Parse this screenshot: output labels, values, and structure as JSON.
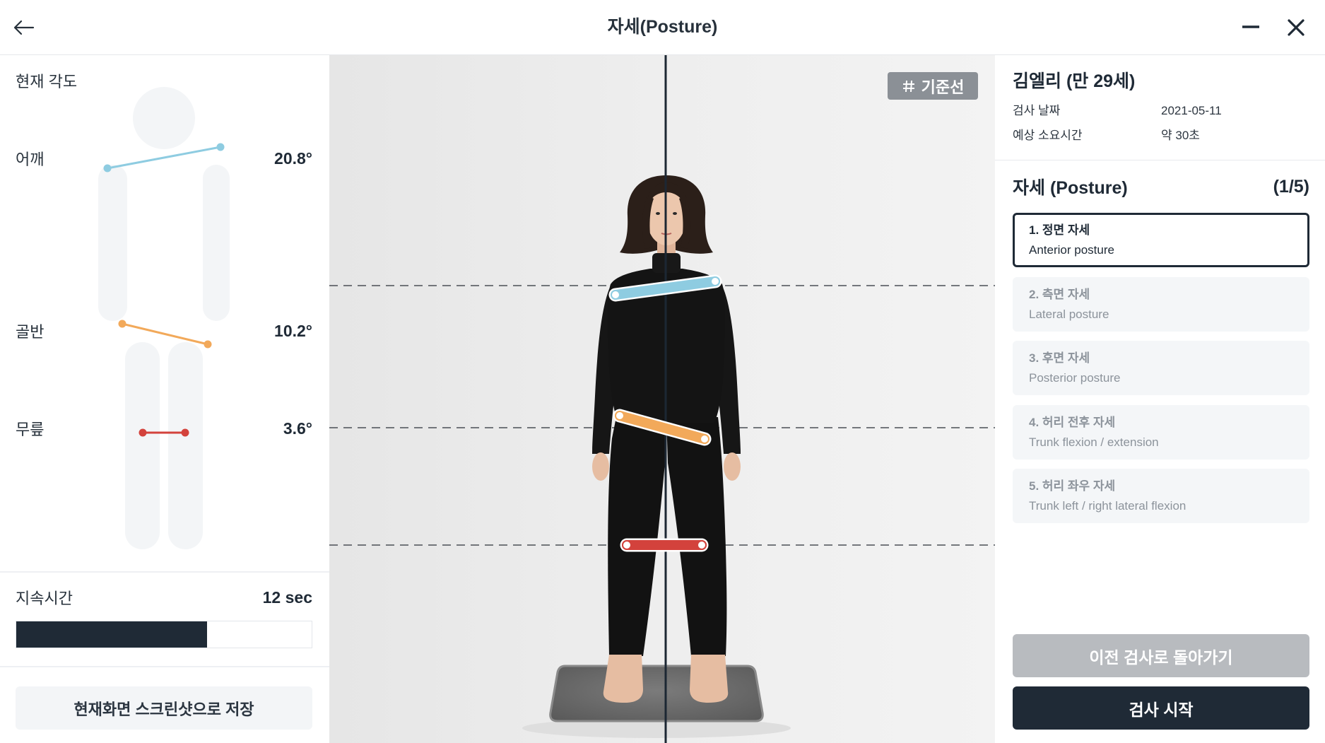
{
  "header": {
    "title": "자세(Posture)",
    "icons": {
      "back": "arrow-left-icon",
      "minimize": "minimize-icon",
      "close": "close-icon"
    }
  },
  "current_angles": {
    "title": "현재 각도",
    "shoulder": {
      "label": "어깨",
      "value": "20.8°"
    },
    "pelvis": {
      "label": "골반",
      "value": "10.2°"
    },
    "knee": {
      "label": "무릎",
      "value": "3.6°"
    }
  },
  "duration": {
    "label": "지속시간",
    "value": "12 sec",
    "progress": 0.645
  },
  "screenshot_button": {
    "label": "현재화면 스크린샷으로 저장"
  },
  "guide_button": {
    "icon": "hash-icon",
    "label": "기준선"
  },
  "patient": {
    "name": "김엘리 (만 29세)",
    "fields": [
      {
        "label": "검사 날짜",
        "value": "2021-05-11"
      },
      {
        "label": "예상 소요시간",
        "value": "약 30초"
      }
    ]
  },
  "test": {
    "title": "자세 (Posture)",
    "progress": "(1/5)",
    "steps": [
      {
        "title": "1. 정면 자세",
        "subtitle": "Anterior posture",
        "active": true
      },
      {
        "title": "2. 측면 자세",
        "subtitle": "Lateral posture",
        "active": false
      },
      {
        "title": "3. 후면 자세",
        "subtitle": "Posterior posture",
        "active": false
      },
      {
        "title": "4. 허리 전후 자세",
        "subtitle": "Trunk flexion / extension",
        "active": false
      },
      {
        "title": "5. 허리 좌우 자세",
        "subtitle": "Trunk left / right lateral flexion",
        "active": false
      }
    ]
  },
  "actions": {
    "previous": "이전 검사로 돌아가기",
    "start": "검사 시작"
  },
  "colors": {
    "shoulder": "#8ecce1",
    "pelvis": "#f2a95a",
    "knee": "#d3423c",
    "primary": "#1f2a36",
    "guide": "#8b9096",
    "disabled": "#b8bbbf"
  }
}
